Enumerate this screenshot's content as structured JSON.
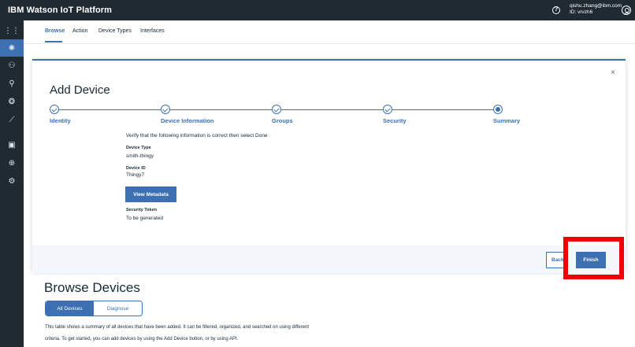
{
  "app": {
    "title": "IBM Watson IoT Platform",
    "user_email": "qishu.zhang@ibm.com",
    "user_id": "ID: vrvzh6",
    "icons": {
      "help": "help-icon",
      "user": "user-profile-icon"
    }
  },
  "sidebar": {
    "items": [
      {
        "icon": "apps-grid-icon",
        "glyph": "⋮⋮",
        "active": false
      },
      {
        "icon": "devices-gear-icon",
        "glyph": "✺",
        "active": true
      },
      {
        "icon": "members-icon",
        "glyph": "⚇",
        "active": false
      },
      {
        "icon": "apps-person-icon",
        "glyph": "⚲",
        "active": false
      },
      {
        "icon": "rules-icon",
        "glyph": "❂",
        "active": false
      },
      {
        "icon": "analytics-icon",
        "glyph": "⟋",
        "active": false
      },
      {
        "icon": "extensions-icon",
        "glyph": "▣",
        "active": false
      },
      {
        "icon": "security-lock-icon",
        "glyph": "⊕",
        "active": false
      },
      {
        "icon": "settings-icon",
        "glyph": "⚙",
        "active": false
      }
    ]
  },
  "tabs": [
    "Browse",
    "Action",
    "Device Types",
    "Interfaces"
  ],
  "modal": {
    "title": "Add Device",
    "close_glyph": "×",
    "steps": [
      {
        "label": "Identity",
        "state": "complete"
      },
      {
        "label": "Device Information",
        "state": "complete"
      },
      {
        "label": "Groups",
        "state": "complete"
      },
      {
        "label": "Security",
        "state": "complete"
      },
      {
        "label": "Summary",
        "state": "current"
      }
    ],
    "verify_text": "Verify that the following information is correct then select Done",
    "device_type_label": "Device Type",
    "device_type_value": "smith-thingy",
    "device_id_label": "Device ID",
    "device_id_value": "Thingy7",
    "view_metadata_label": "View Metadata",
    "security_token_label": "Security Token",
    "security_token_value": "To be generated",
    "back_label": "Back",
    "finish_label": "Finish"
  },
  "browse": {
    "title": "Browse Devices",
    "segments": [
      "All Devices",
      "Diagnose"
    ],
    "description_line1": "This table shows a summary of all devices that have been added. It can be filtered, organized, and searched on using different",
    "description_line2": "criteria. To get started, you can add devices by using the Add Device button, or by using API."
  },
  "colors": {
    "accent": "#3d70b2",
    "topbar": "#1f2a33",
    "highlight": "#f00000"
  }
}
